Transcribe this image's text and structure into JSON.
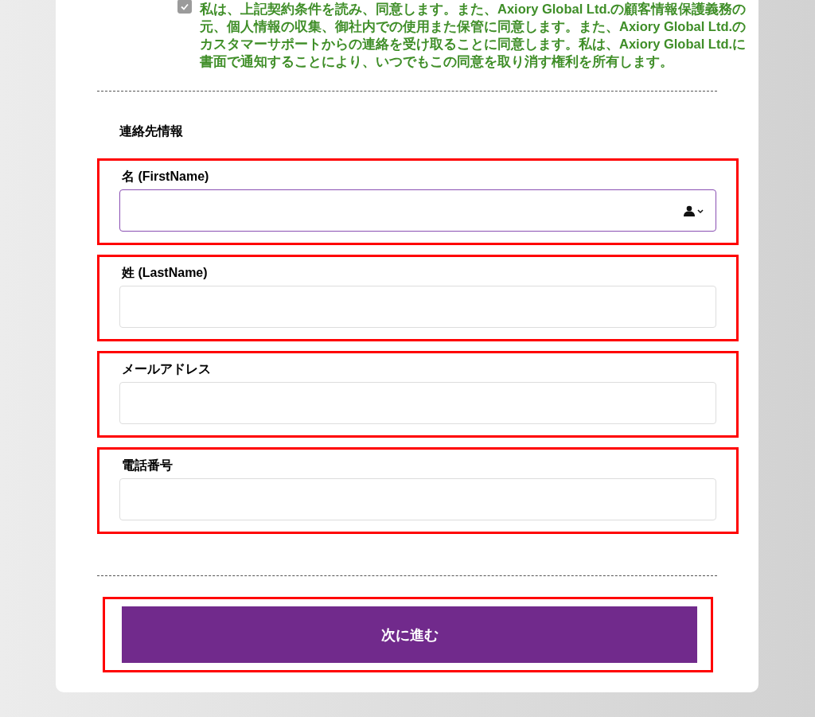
{
  "consent": {
    "checked": true,
    "text": "私は、上記契約条件を読み、同意します。また、Axiory Global Ltd.の顧客情報保護義務の元、個人情報の収集、御社内での使用また保管に同意します。また、Axiory Global Ltd.のカスタマーサポートからの連絡を受け取ることに同意します。私は、Axiory Global Ltd.に書面で通知することにより、いつでもこの同意を取り消す権利を所有します。"
  },
  "section_title": "連絡先情報",
  "fields": [
    {
      "label": "名 (FirstName)",
      "focused": true,
      "autofill_icon": true
    },
    {
      "label": "姓 (LastName)",
      "focused": false,
      "autofill_icon": false
    },
    {
      "label": "メールアドレス",
      "focused": false,
      "autofill_icon": false
    },
    {
      "label": "電話番号",
      "focused": false,
      "autofill_icon": false
    }
  ],
  "submit_button": "次に進む"
}
